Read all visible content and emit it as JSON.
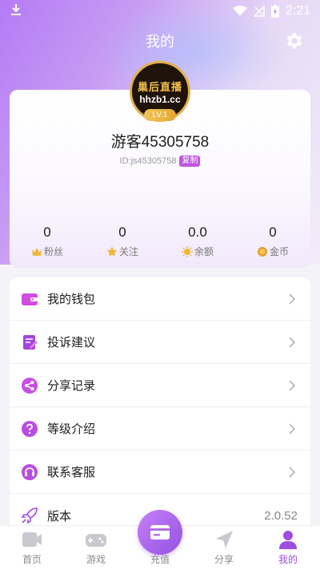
{
  "status_bar": {
    "time": "2:21"
  },
  "header": {
    "title": "我的"
  },
  "profile": {
    "avatar_text_1": "巢后直播",
    "avatar_text_2": "hhzb1.cc",
    "level": "LV.1",
    "username": "游客45305758",
    "user_id": "ID:js45305758",
    "copy_label": "复制"
  },
  "stats": [
    {
      "value": "0",
      "label": "粉丝",
      "icon": "crown-icon",
      "color": "#f2b535"
    },
    {
      "value": "0",
      "label": "关注",
      "icon": "star-icon",
      "color": "#f2b535"
    },
    {
      "value": "0.0",
      "label": "余额",
      "icon": "sun-coin-icon",
      "color": "#f2b535"
    },
    {
      "value": "0",
      "label": "金币",
      "icon": "gold-coin-icon",
      "color": "#e0a230"
    }
  ],
  "menu": [
    {
      "label": "我的钱包",
      "icon": "wallet-icon"
    },
    {
      "label": "投诉建议",
      "icon": "feedback-icon"
    },
    {
      "label": "分享记录",
      "icon": "share-icon"
    },
    {
      "label": "等级介绍",
      "icon": "question-icon"
    },
    {
      "label": "联系客服",
      "icon": "headset-icon"
    },
    {
      "label": "版本",
      "icon": "rocket-icon",
      "value": "2.0.52"
    }
  ],
  "bottom_nav": [
    {
      "label": "首页",
      "icon": "video-icon"
    },
    {
      "label": "游戏",
      "icon": "gamepad-icon"
    },
    {
      "label": "充值",
      "icon": "card-icon"
    },
    {
      "label": "分享",
      "icon": "send-icon"
    },
    {
      "label": "我的",
      "icon": "user-icon"
    }
  ],
  "colors": {
    "accent": "#9d4ee0",
    "badge": "#c254e0",
    "gold": "#e5a832"
  }
}
